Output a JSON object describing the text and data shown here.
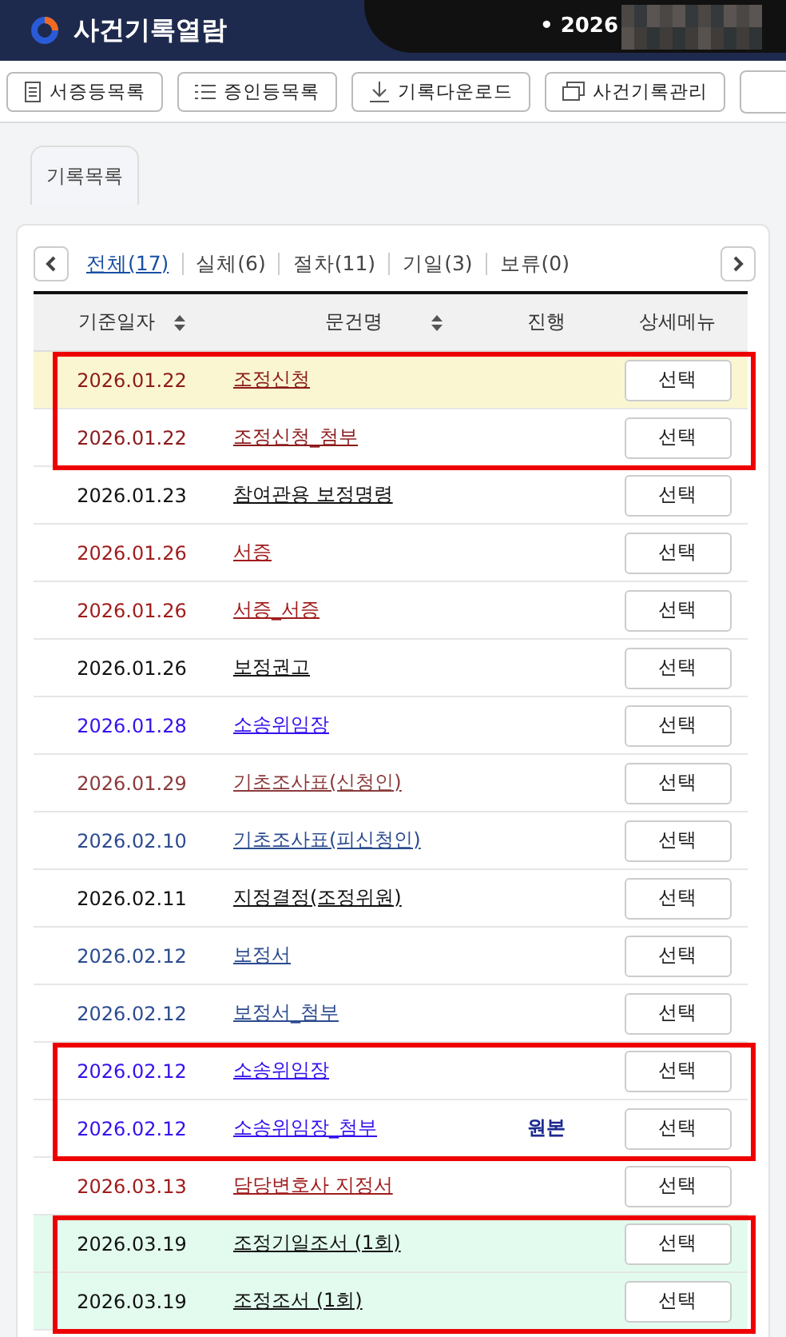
{
  "header": {
    "title": "사건기록열람",
    "case_label": "• 2026"
  },
  "toolbar": [
    {
      "label": "서증등목록",
      "kind": "document"
    },
    {
      "label": "증인등목록",
      "kind": "list"
    },
    {
      "label": "기록다운로드",
      "kind": "download"
    },
    {
      "label": "사건기록관리",
      "kind": "windows"
    }
  ],
  "tabs": [
    {
      "label": "기록목록",
      "selected": true
    }
  ],
  "filters": [
    {
      "label": "전체(17)",
      "selected": true
    },
    {
      "label": "실체(6)",
      "selected": false
    },
    {
      "label": "절차(11)",
      "selected": false
    },
    {
      "label": "기일(3)",
      "selected": false
    },
    {
      "label": "보류(0)",
      "selected": false
    }
  ],
  "table": {
    "columns": [
      {
        "label": "기준일자",
        "sortable": true
      },
      {
        "label": "문건명",
        "sortable": true
      },
      {
        "label": "진행",
        "sortable": false
      },
      {
        "label": "상세메뉴",
        "sortable": false
      }
    ],
    "blocks": [
      {
        "framed": true,
        "rows": [
          {
            "date": "2026.01.22",
            "title": "조정신청",
            "color": "#8b1a1a",
            "kind": "document",
            "selected": true,
            "button": "선택"
          },
          {
            "date": "2026.01.22",
            "title": "조정신청_첨부",
            "color": "#8b1a1a",
            "kind": "document",
            "selected": false,
            "button": "선택"
          }
        ]
      },
      {
        "framed": false,
        "rows": [
          {
            "date": "2026.01.23",
            "title": "참여관용 보정명령",
            "color": "#111111",
            "kind": "document",
            "selected": false,
            "button": "선택"
          },
          {
            "date": "2026.01.26",
            "title": "서증",
            "color": "#a01c1c",
            "kind": "document",
            "selected": false,
            "button": "선택"
          },
          {
            "date": "2026.01.26",
            "title": "서증_서증",
            "color": "#a01c1c",
            "kind": "document",
            "selected": false,
            "button": "선택"
          },
          {
            "date": "2026.01.26",
            "title": "보정권고",
            "color": "#111111",
            "kind": "document",
            "selected": false,
            "button": "선택"
          },
          {
            "date": "2026.01.28",
            "title": "소송위임장",
            "color": "#3311ee",
            "kind": "document",
            "selected": false,
            "button": "선택"
          },
          {
            "date": "2026.01.29",
            "title": "기초조사표(신청인)",
            "color": "#8b3a3a",
            "kind": "document",
            "selected": false,
            "button": "선택"
          },
          {
            "date": "2026.02.10",
            "title": "기초조사표(피신청인)",
            "color": "#2b4b8f",
            "kind": "document",
            "selected": false,
            "button": "선택"
          },
          {
            "date": "2026.02.11",
            "title": "지정결정(조정위원)",
            "color": "#111111",
            "kind": "document",
            "selected": false,
            "button": "선택"
          },
          {
            "date": "2026.02.12",
            "title": "보정서",
            "color": "#2b4b8f",
            "kind": "document",
            "selected": false,
            "button": "선택"
          },
          {
            "date": "2026.02.12",
            "title": "보정서_첨부",
            "color": "#2b4b8f",
            "kind": "document",
            "selected": false,
            "button": "선택"
          }
        ]
      },
      {
        "framed": true,
        "rows": [
          {
            "date": "2026.02.12",
            "title": "소송위임장",
            "color": "#3311ee",
            "kind": "document",
            "selected": false,
            "button": "선택"
          },
          {
            "date": "2026.02.12",
            "title": "소송위임장_첨부",
            "color": "#3311ee",
            "kind": "document",
            "selected": false,
            "progress": "원본",
            "button": "선택"
          }
        ]
      },
      {
        "framed": false,
        "rows": [
          {
            "date": "2026.03.13",
            "title": "담당변호사 지정서",
            "color": "#a01c1c",
            "kind": "document",
            "selected": false,
            "button": "선택"
          }
        ]
      },
      {
        "framed": true,
        "rows": [
          {
            "date": "2026.03.19",
            "title": "조정기일조서 (1회)",
            "color": "#111111",
            "kind": "hearing",
            "selected": false,
            "button": "선택"
          },
          {
            "date": "2026.03.19",
            "title": "조정조서 (1회)",
            "color": "#111111",
            "kind": "hearing",
            "selected": false,
            "button": "선택"
          }
        ]
      }
    ]
  }
}
